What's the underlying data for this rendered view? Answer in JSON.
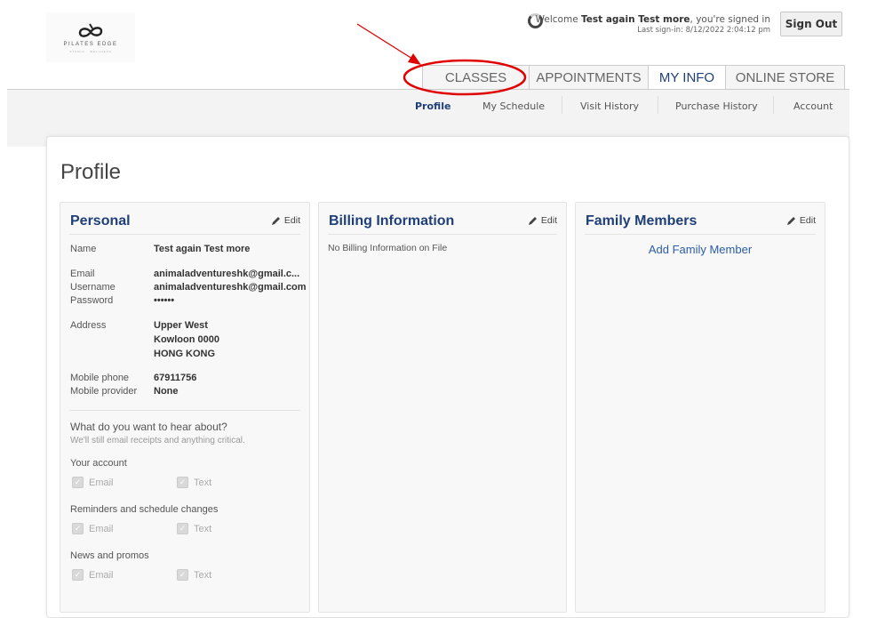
{
  "header": {
    "logo_text": "PILATES EDGE",
    "logo_subtext": "STUDIO · WELLNESS",
    "welcome_prefix": "Welcome ",
    "user_name": "Test again Test more",
    "welcome_suffix": ", you're signed in",
    "last_signin": "Last sign-in: 8/12/2022 2:04:12 pm",
    "sign_out": "Sign Out"
  },
  "tabs": [
    {
      "label": "CLASSES",
      "active": false
    },
    {
      "label": "APPOINTMENTS",
      "active": false
    },
    {
      "label": "MY INFO",
      "active": true
    },
    {
      "label": "ONLINE STORE",
      "active": false
    }
  ],
  "subnav": [
    {
      "label": "Profile",
      "active": true
    },
    {
      "label": "My Schedule",
      "active": false
    },
    {
      "label": "Visit History",
      "active": false
    },
    {
      "label": "Purchase History",
      "active": false
    },
    {
      "label": "Account",
      "active": false
    }
  ],
  "page_title": "Profile",
  "edit_label": "Edit",
  "personal": {
    "title": "Personal",
    "name_label": "Name",
    "name": "Test again Test more",
    "email_label": "Email",
    "email": "animaladventureshk@gmail.c...",
    "username_label": "Username",
    "username": "animaladventureshk@gmail.com",
    "password_label": "Password",
    "password": "••••••",
    "address_label": "Address",
    "address_line1": "Upper West",
    "address_line2": "Kowloon 0000",
    "address_line3": "HONG KONG",
    "mobile_phone_label": "Mobile phone",
    "mobile_phone": "67911756",
    "mobile_provider_label": "Mobile provider",
    "mobile_provider": "None",
    "notify_question": "What do you want to hear about?",
    "notify_sub": "We'll still email receipts and anything critical.",
    "groups": [
      {
        "label": "Your account",
        "email": "Email",
        "text": "Text"
      },
      {
        "label": "Reminders and schedule changes",
        "email": "Email",
        "text": "Text"
      },
      {
        "label": "News and promos",
        "email": "Email",
        "text": "Text"
      }
    ]
  },
  "billing": {
    "title": "Billing Information",
    "empty_text": "No Billing Information on File"
  },
  "family": {
    "title": "Family Members",
    "add_link": "Add Family Member"
  },
  "colors": {
    "accent": "#1f3f7a",
    "link": "#2a5da8",
    "annotation": "#e00000"
  }
}
